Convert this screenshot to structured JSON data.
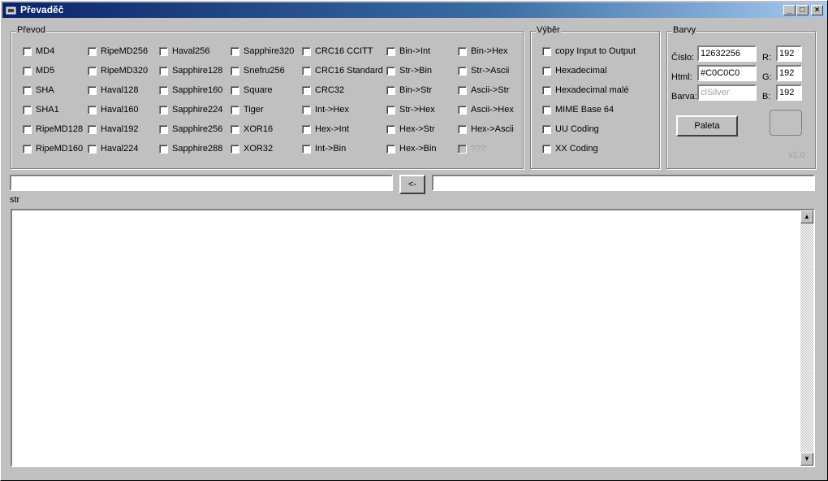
{
  "window": {
    "title": "Převaděč"
  },
  "title_buttons": {
    "minimize": "_",
    "maximize": "□",
    "close": "×"
  },
  "prevod": {
    "label": "Převod",
    "columns": [
      [
        "MD4",
        "MD5",
        "SHA",
        "SHA1",
        "RipeMD128",
        "RipeMD160"
      ],
      [
        "RipeMD256",
        "RipeMD320",
        "Haval128",
        "Haval160",
        "Haval192",
        "Haval224"
      ],
      [
        "Haval256",
        "Sapphire128",
        "Sapphire160",
        "Sapphire224",
        "Sapphire256",
        "Sapphire288"
      ],
      [
        "Sapphire320",
        "Snefru256",
        "Square",
        "Tiger",
        "XOR16",
        "XOR32"
      ],
      [
        "CRC16 CCITT",
        "CRC16 Standard",
        "CRC32",
        "Int->Hex",
        "Hex->Int",
        "Int->Bin"
      ],
      [
        "Bin->Int",
        "Str->Bin",
        "Bin->Str",
        "Str->Hex",
        "Hex->Str",
        "Hex->Bin"
      ],
      [
        "Bin->Hex",
        "Str->Ascii",
        "Ascii->Str",
        "Ascii->Hex",
        "Hex->Ascii",
        "???"
      ]
    ]
  },
  "vyber": {
    "label": "Výběr",
    "items": [
      "copy Input to Output",
      "Hexadecimal",
      "Hexadecimal malé",
      "MIME Base 64",
      "UU Coding",
      "XX Coding"
    ]
  },
  "barvy": {
    "label": "Barvy",
    "cislo_label": "Číslo:",
    "cislo_value": "12632256",
    "html_label": "Html:",
    "html_value": "#C0C0C0",
    "barva_label": "Barva:",
    "barva_value": "clSilver",
    "r_label": "R:",
    "r_value": "192",
    "g_label": "G:",
    "g_value": "192",
    "b_label": "B:",
    "b_value": "192",
    "paleta_button": "Paleta",
    "version": "v1.0",
    "swatch_color": "#c0c0c0"
  },
  "io": {
    "input_value": "",
    "arrow_button": "<-",
    "output_value": "",
    "str_label": "str"
  },
  "memo": {
    "text": ""
  }
}
